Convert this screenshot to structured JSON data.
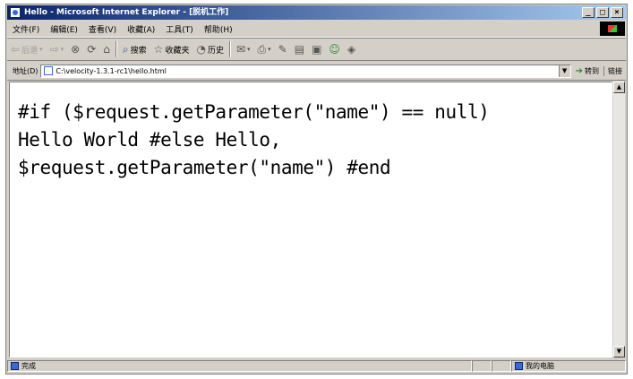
{
  "window": {
    "title": "Hello - Microsoft Internet Explorer - [脱机工作]"
  },
  "caption_buttons": {
    "minimize": "_",
    "maximize": "□",
    "close": "×"
  },
  "menu": {
    "items": [
      "文件(F)",
      "编辑(E)",
      "查看(V)",
      "收藏(A)",
      "工具(T)",
      "帮助(H)"
    ]
  },
  "toolbar": {
    "back_label": "后退",
    "search_label": "搜索",
    "favorites_label": "收藏夹",
    "history_label": "历史"
  },
  "address": {
    "label": "地址(D)",
    "url": "C:\\velocity-1.3.1-rc1\\hello.html",
    "go_label": "转到",
    "links_label": "链接"
  },
  "page": {
    "code_lines": [
      "#if ($request.getParameter(\"name\") == null)",
      "Hello World #else Hello,",
      "$request.getParameter(\"name\") #end"
    ]
  },
  "status": {
    "text": "完成",
    "zone": "我的电脑"
  },
  "icons": [
    "ie-icon",
    "back-icon",
    "forward-icon",
    "stop-icon",
    "refresh-icon",
    "home-icon",
    "search-icon",
    "favorites-icon",
    "history-icon",
    "mail-icon",
    "print-icon",
    "edit-icon",
    "discuss-icon",
    "messenger-icon",
    "go-icon",
    "page-icon",
    "computer-icon"
  ]
}
